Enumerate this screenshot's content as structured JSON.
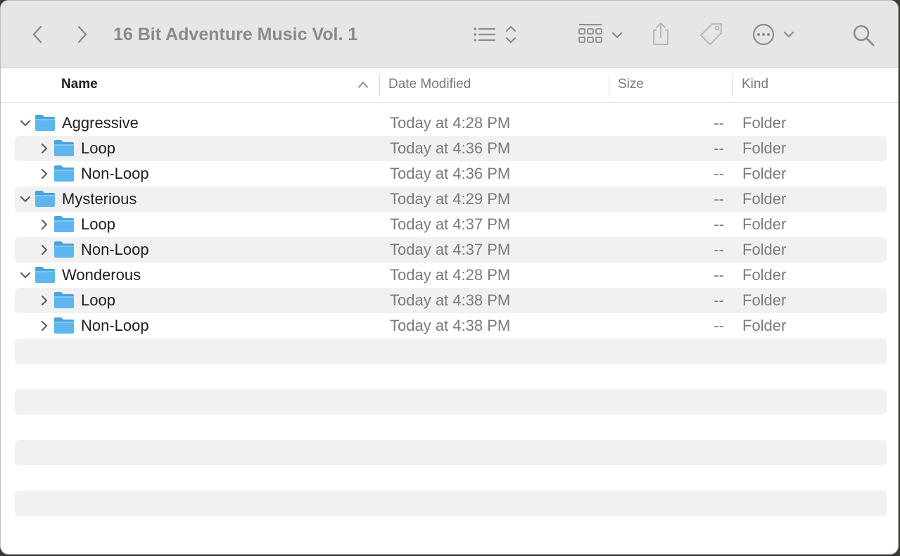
{
  "window": {
    "title": "16 Bit Adventure Music Vol. 1"
  },
  "toolbar": {
    "back_icon": "chevron-left-icon",
    "forward_icon": "chevron-right-icon",
    "view_icon": "list-view-icon",
    "group_icon": "grid-group-icon",
    "share_icon": "share-icon",
    "tag_icon": "tag-icon",
    "more_icon": "ellipsis-circle-icon",
    "search_icon": "search-icon"
  },
  "columns": {
    "name": "Name",
    "date": "Date Modified",
    "size": "Size",
    "kind": "Kind"
  },
  "rows": [
    {
      "name": "Aggressive",
      "date": "Today at 4:28 PM",
      "size": "--",
      "kind": "Folder",
      "level": 0,
      "expanded": true
    },
    {
      "name": "Loop",
      "date": "Today at 4:36 PM",
      "size": "--",
      "kind": "Folder",
      "level": 1,
      "expanded": false
    },
    {
      "name": "Non-Loop",
      "date": "Today at 4:36 PM",
      "size": "--",
      "kind": "Folder",
      "level": 1,
      "expanded": false
    },
    {
      "name": "Mysterious",
      "date": "Today at 4:29 PM",
      "size": "--",
      "kind": "Folder",
      "level": 0,
      "expanded": true
    },
    {
      "name": "Loop",
      "date": "Today at 4:37 PM",
      "size": "--",
      "kind": "Folder",
      "level": 1,
      "expanded": false
    },
    {
      "name": "Non-Loop",
      "date": "Today at 4:37 PM",
      "size": "--",
      "kind": "Folder",
      "level": 1,
      "expanded": false
    },
    {
      "name": "Wonderous",
      "date": "Today at 4:28 PM",
      "size": "--",
      "kind": "Folder",
      "level": 0,
      "expanded": true
    },
    {
      "name": "Loop",
      "date": "Today at 4:38 PM",
      "size": "--",
      "kind": "Folder",
      "level": 1,
      "expanded": false
    },
    {
      "name": "Non-Loop",
      "date": "Today at 4:38 PM",
      "size": "--",
      "kind": "Folder",
      "level": 1,
      "expanded": false
    }
  ],
  "colors": {
    "folder_fill": "#5fb6ee",
    "folder_tab": "#4aa3de",
    "toolbar_bg": "#e6e6e6",
    "stripe": "#f1f1f1"
  }
}
